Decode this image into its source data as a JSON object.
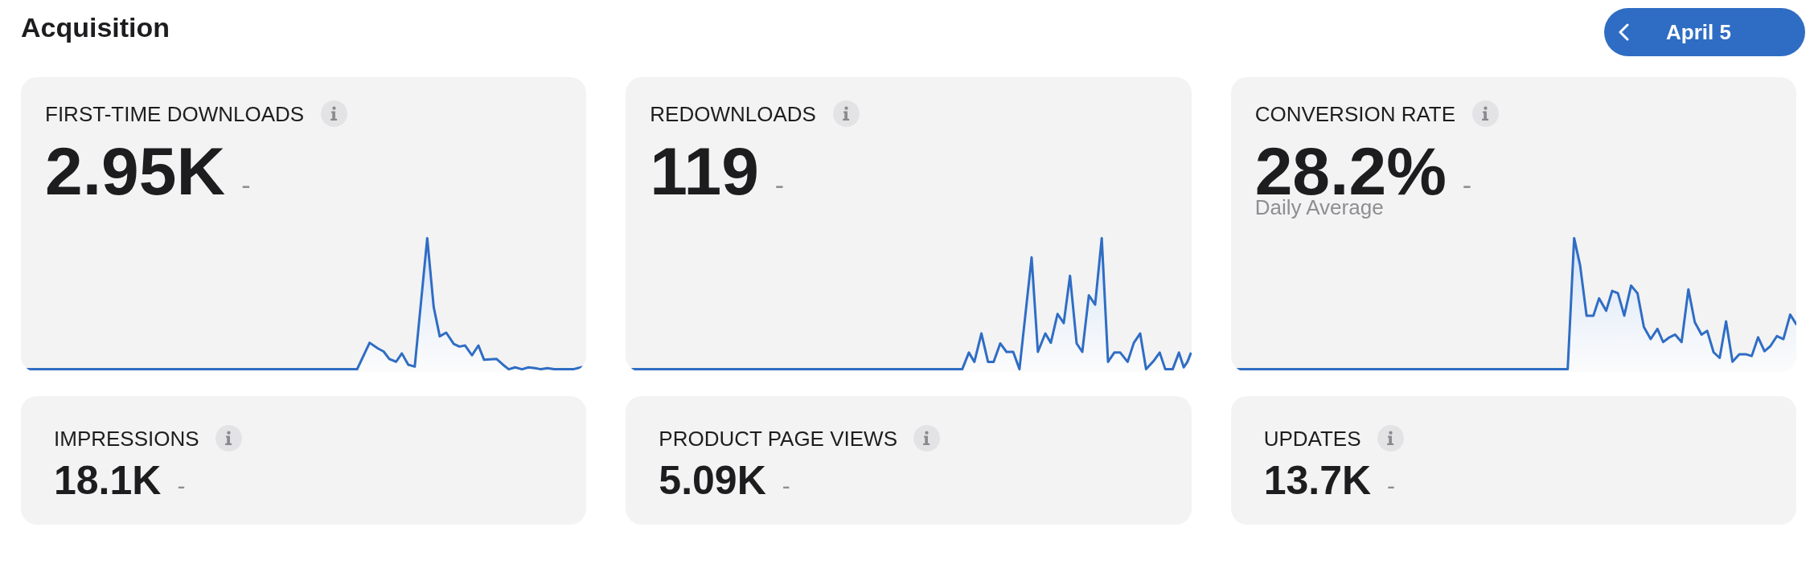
{
  "header": {
    "title": "Acquisition",
    "date_button": {
      "label": "April 5"
    }
  },
  "chart_cards": [
    {
      "label": "FIRST-TIME DOWNLOADS",
      "value": "2.95K",
      "change": "-"
    },
    {
      "label": "REDOWNLOADS",
      "value": "119",
      "change": "-"
    },
    {
      "label": "CONVERSION RATE",
      "value": "28.2%",
      "change": "-",
      "note": "Daily Average"
    }
  ],
  "summary_cards": [
    {
      "label": "IMPRESSIONS",
      "value": "18.1K",
      "change": "-"
    },
    {
      "label": "PRODUCT PAGE VIEWS",
      "value": "5.09K",
      "change": "-"
    },
    {
      "label": "UPDATES",
      "value": "13.7K",
      "change": "-"
    }
  ]
}
